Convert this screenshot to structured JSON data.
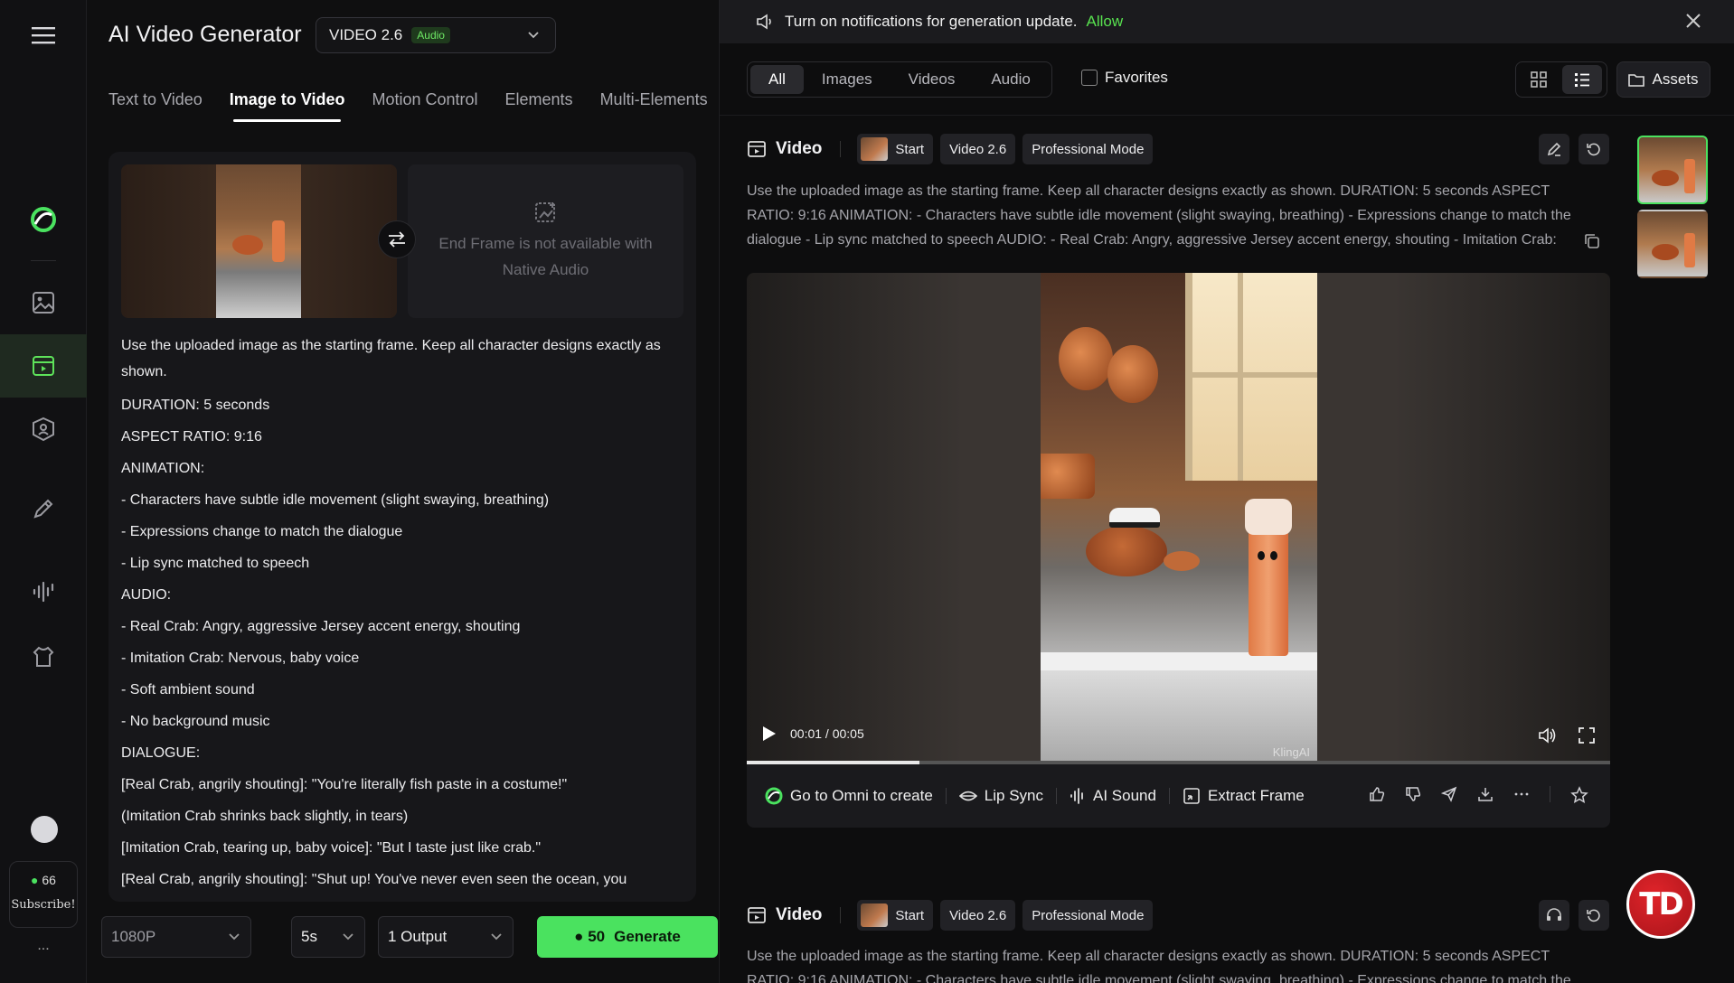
{
  "app": {
    "title": "AI Video Generator",
    "model": "VIDEO 2.6",
    "model_badge": "Audio"
  },
  "tabs": [
    "Text to Video",
    "Image to Video",
    "Motion Control",
    "Elements",
    "Multi-Elements"
  ],
  "active_tab": "Image to Video",
  "frames": {
    "end_frame_msg": "End Frame is not available with Native Audio"
  },
  "prompt_lines": [
    "Use the uploaded image as the starting frame. Keep all character designs exactly as shown.",
    "DURATION: 5 seconds",
    "ASPECT RATIO: 9:16",
    "ANIMATION:",
    "- Characters have subtle idle movement (slight swaying, breathing)",
    "- Expressions change to match the dialogue",
    "- Lip sync matched to speech",
    "AUDIO:",
    "- Real Crab: Angry, aggressive Jersey accent energy, shouting",
    "- Imitation Crab: Nervous, baby voice",
    "- Soft ambient sound",
    "- No background music",
    "DIALOGUE:",
    "[Real Crab, angrily shouting]: \"You're literally fish paste in a costume!\"",
    "(Imitation Crab shrinks back slightly, in tears)",
    "[Imitation Crab, tearing up, baby voice]: \"But I taste just like crab.\"",
    "[Real Crab, angrily shouting]: \"Shut up! You've never even seen the ocean, you"
  ],
  "bottom": {
    "resolution": "1080P",
    "duration": "5s",
    "outputs": "1 Output",
    "credits_cost": "50",
    "generate_label": "Generate"
  },
  "rail": {
    "credits": "66",
    "subscribe": "Subscribe!",
    "more": "..."
  },
  "notification": {
    "text": "Turn on notifications for generation update.",
    "allow": "Allow"
  },
  "filters": [
    "All",
    "Images",
    "Videos",
    "Audio"
  ],
  "active_filter": "All",
  "favorites_label": "Favorites",
  "assets_label": "Assets",
  "cards": [
    {
      "type_label": "Video",
      "start_label": "Start",
      "model_label": "Video 2.6",
      "mode_label": "Professional Mode",
      "desc_lines": [
        "Use the uploaded image as the starting frame. Keep all character designs exactly as shown. DURATION: 5 seconds ASPECT",
        "RATIO: 9:16 ANIMATION: - Characters have subtle idle movement (slight swaying, breathing) - Expressions change to match the",
        "dialogue - Lip sync matched to speech AUDIO: - Real Crab: Angry, aggressive Jersey accent energy, shouting - Imitation Crab:"
      ]
    },
    {
      "type_label": "Video",
      "start_label": "Start",
      "model_label": "Video 2.6",
      "mode_label": "Professional Mode",
      "desc_lines": [
        "Use the uploaded image as the starting frame. Keep all character designs exactly as shown. DURATION: 5 seconds ASPECT",
        "RATIO: 9:16 ANIMATION: - Characters have subtle idle movement (slight swaying, breathing) - Expressions change to match the"
      ]
    }
  ],
  "player": {
    "time": "00:01 / 00:05",
    "progress": 0.2,
    "watermark": "KlingAI"
  },
  "actions": {
    "omni": "Go to Omni to create",
    "lip_sync": "Lip Sync",
    "ai_sound": "AI Sound",
    "extract_frame": "Extract Frame"
  },
  "corner_badge": "TD",
  "colors": {
    "accent_green": "#4ae25f",
    "allow_green": "#58e24f",
    "bg": "#0d0d0e",
    "badge_red": "#c8181e"
  }
}
